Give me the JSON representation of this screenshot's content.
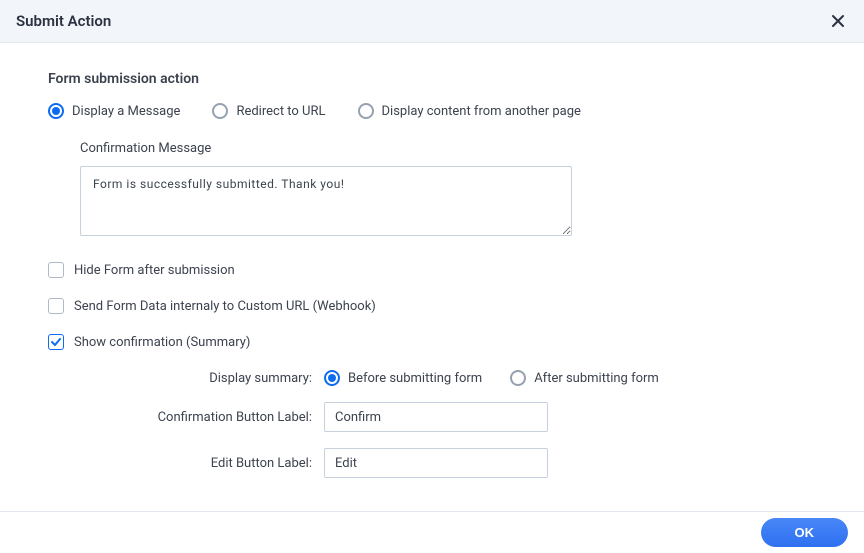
{
  "header": {
    "title": "Submit Action"
  },
  "section": {
    "title": "Form submission action"
  },
  "actionRadios": {
    "displayMessage": {
      "label": "Display a Message",
      "checked": true
    },
    "redirect": {
      "label": "Redirect to URL",
      "checked": false
    },
    "displayContent": {
      "label": "Display content from another page",
      "checked": false
    }
  },
  "confirmation": {
    "label": "Confirmation Message",
    "value": "Form is successfully submitted. Thank you!"
  },
  "checkboxes": {
    "hideForm": {
      "label": "Hide Form after submission",
      "checked": false
    },
    "webhook": {
      "label": "Send Form Data internaly to Custom URL (Webhook)",
      "checked": false
    },
    "showSummary": {
      "label": "Show confirmation (Summary)",
      "checked": true
    }
  },
  "summary": {
    "displayLabel": "Display summary:",
    "before": {
      "label": "Before submitting form",
      "checked": true
    },
    "after": {
      "label": "After submitting form",
      "checked": false
    },
    "confirmBtn": {
      "label": "Confirmation Button Label:",
      "value": "Confirm"
    },
    "editBtn": {
      "label": "Edit Button Label:",
      "value": "Edit"
    }
  },
  "footer": {
    "ok": "OK"
  }
}
